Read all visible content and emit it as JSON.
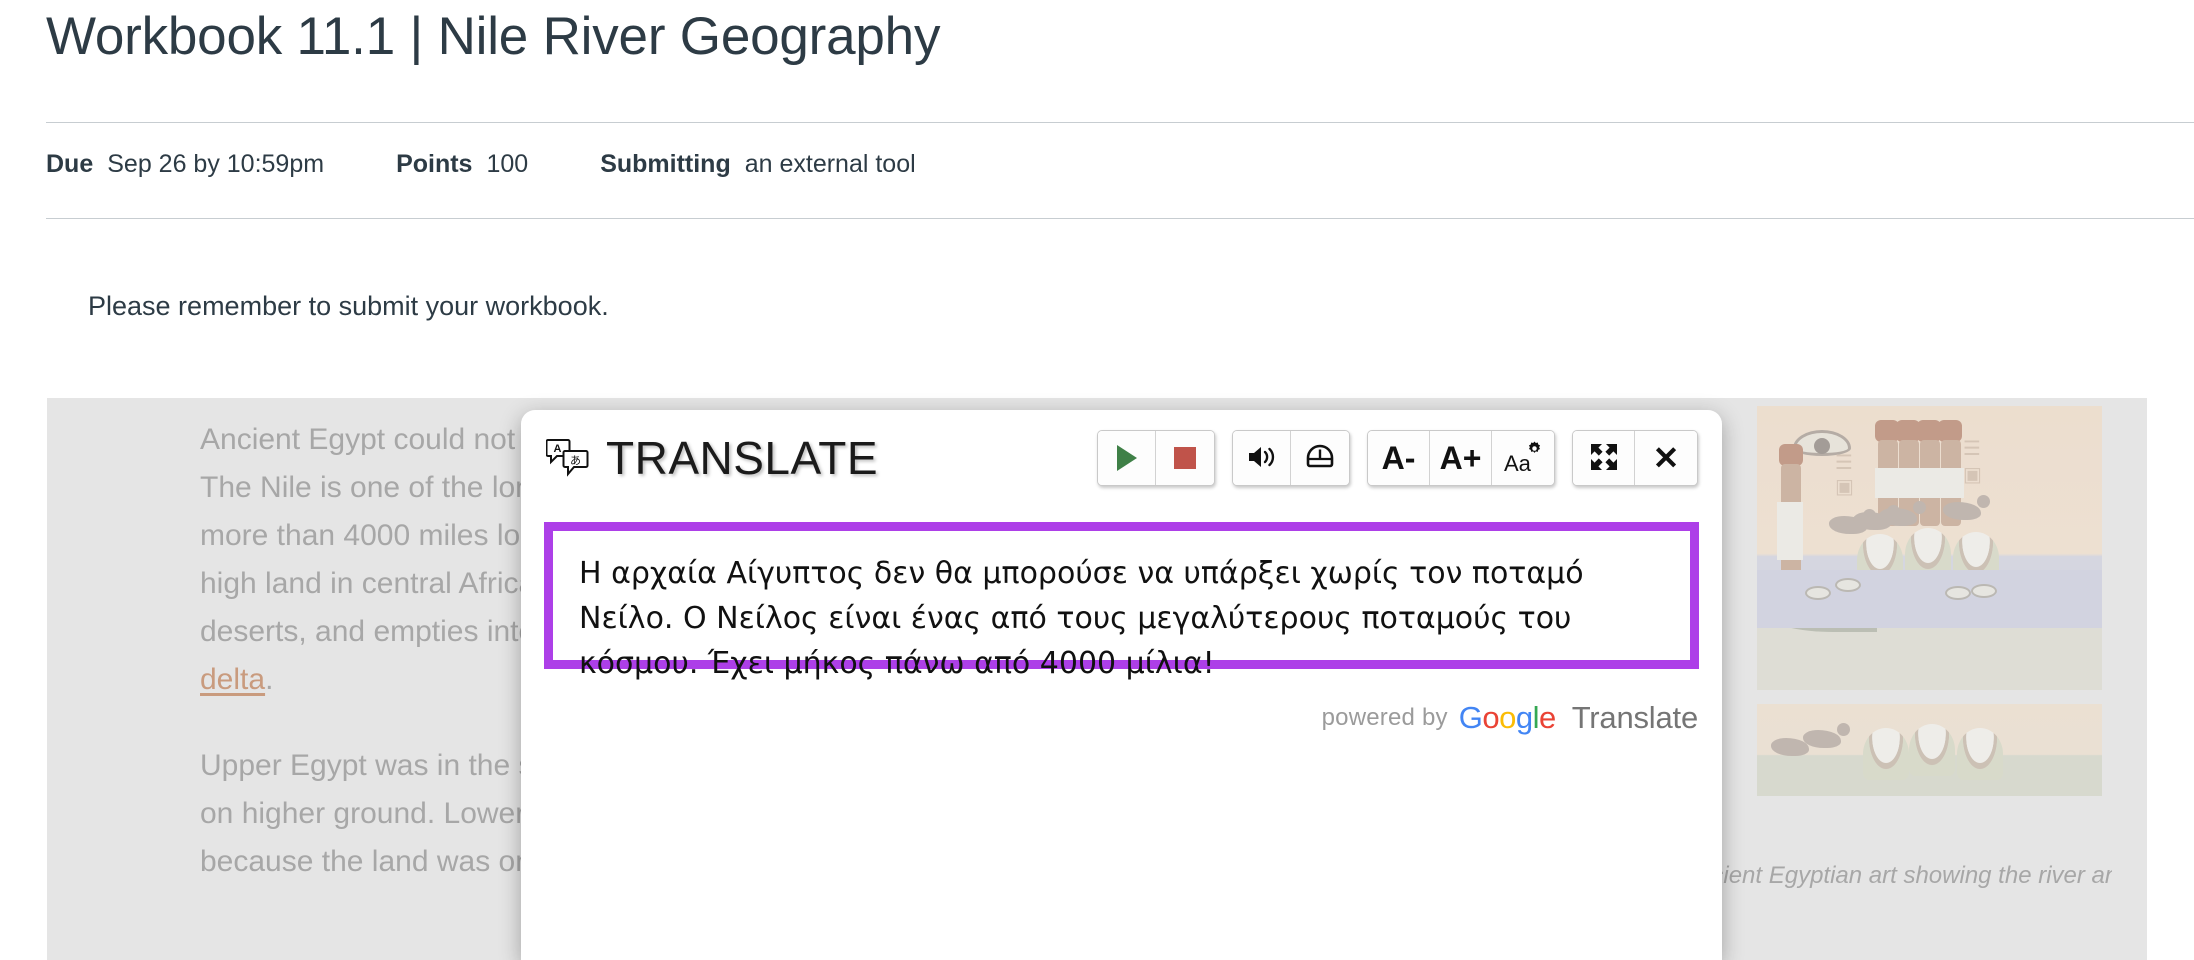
{
  "assignment": {
    "title": "Workbook 11.1 | Nile River Geography",
    "meta": {
      "due_label": "Due",
      "due_value": "Sep 26 by 10:59pm",
      "points_label": "Points",
      "points_value": "100",
      "submitting_label": "Submitting",
      "submitting_value": "an external tool"
    },
    "intro": "Please remember to submit your workbook."
  },
  "workbook": {
    "paragraph_1_pre": "Ancient Egypt could not exist without the Nile River. The Nile is one of the longest rivers in the world. It is more than 4000 miles long! The Nile River starts in high land in central Africa, flows through Egyptian deserts, and empties into the sea. The Nile ends in a ",
    "paragraph_1_link": "delta",
    "paragraph_1_post": ".",
    "paragraph_2": "Upper Egypt was in the south because the land was on higher ground. Lower Egypt was in the north because the land was on lower ground near the sea.",
    "image_caption": "Ancient Egyptian art showing the river and green plants brought by the flood"
  },
  "translate_panel": {
    "title": "TRANSLATE",
    "logo_icon": "translate-bubbles-icon",
    "toolbar": [
      {
        "name": "play-button",
        "icon": "play-icon",
        "label": ""
      },
      {
        "name": "stop-button",
        "icon": "stop-icon",
        "label": ""
      },
      {
        "name": "volume-button",
        "icon": "speaker-icon",
        "label": ""
      },
      {
        "name": "speed-button",
        "icon": "speedometer-icon",
        "label": ""
      },
      {
        "name": "decrease-font-button",
        "icon": "font-decrease-icon",
        "label": "A-"
      },
      {
        "name": "increase-font-button",
        "icon": "font-increase-icon",
        "label": "A+"
      },
      {
        "name": "font-settings-button",
        "icon": "font-settings-icon",
        "label": "Aa"
      },
      {
        "name": "fullscreen-button",
        "icon": "expand-arrows-icon",
        "label": ""
      },
      {
        "name": "close-button",
        "icon": "close-x-icon",
        "label": "✕"
      }
    ],
    "translated_text": "Η αρχαία Αίγυπτος δεν θα μπορούσε να υπάρξει χωρίς τον ποταμό Νείλο. Ο Νείλος είναι ένας από τους μεγαλύτερους ποταμούς του κόσμου. Έχει μήκος πάνω από 4000 μίλια!",
    "powered_by": "powered by",
    "brand_letters": [
      "G",
      "o",
      "o",
      "g",
      "l",
      "e"
    ],
    "brand_word": "Translate",
    "border_color": "#ad3fe8"
  },
  "colors": {
    "accent_purple": "#ad3fe8",
    "content_gray": "#e5e5e5",
    "muted_text": "#a7a7a7",
    "link_tan": "#c99b7e",
    "play_green": "#3f8047",
    "stop_red": "#c0534a",
    "google_blue": "#4285F4",
    "google_red": "#EA4335",
    "google_yellow": "#FBBC05",
    "google_green": "#34A853"
  }
}
